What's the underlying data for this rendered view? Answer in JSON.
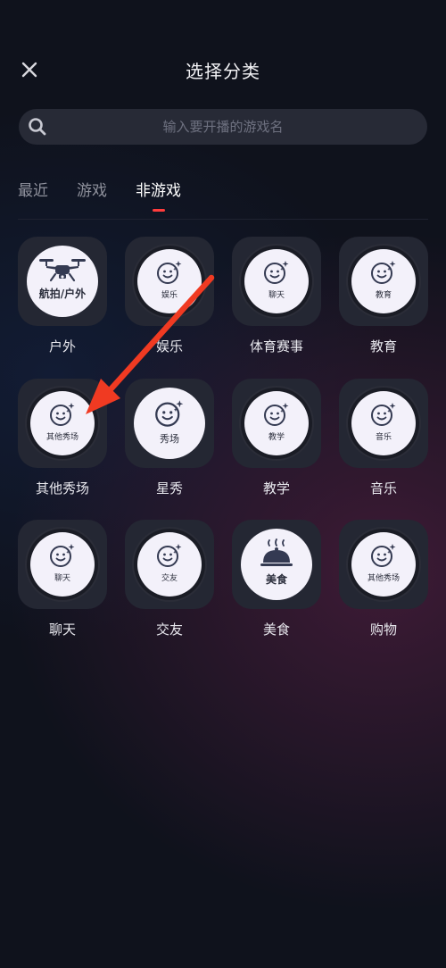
{
  "header": {
    "title": "选择分类",
    "close_icon": "close-icon"
  },
  "search": {
    "placeholder": "输入要开播的游戏名",
    "value": ""
  },
  "tabs": [
    {
      "label": "最近",
      "active": false
    },
    {
      "label": "游戏",
      "active": false
    },
    {
      "label": "非游戏",
      "active": true
    }
  ],
  "categories": [
    {
      "label": "户外",
      "badge_text": "航拍/户外",
      "icon": "drone-icon"
    },
    {
      "label": "娱乐",
      "badge_text": "娱乐",
      "icon": "smile-icon"
    },
    {
      "label": "体育赛事",
      "badge_text": "聊天",
      "icon": "smile-icon"
    },
    {
      "label": "教育",
      "badge_text": "教育",
      "icon": "smile-icon"
    },
    {
      "label": "其他秀场",
      "badge_text": "其他秀场",
      "icon": "smile-icon"
    },
    {
      "label": "星秀",
      "badge_text": "秀场",
      "icon": "smile-icon"
    },
    {
      "label": "教学",
      "badge_text": "教学",
      "icon": "smile-icon"
    },
    {
      "label": "音乐",
      "badge_text": "音乐",
      "icon": "smile-icon"
    },
    {
      "label": "聊天",
      "badge_text": "聊天",
      "icon": "smile-icon"
    },
    {
      "label": "交友",
      "badge_text": "交友",
      "icon": "smile-icon"
    },
    {
      "label": "美食",
      "badge_text": "美食",
      "icon": "food-cloche-icon"
    },
    {
      "label": "购物",
      "badge_text": "其他秀场",
      "icon": "smile-icon"
    }
  ],
  "colors": {
    "accent": "#ff3c3c",
    "arrow": "#f03a22",
    "background": "#0f121c",
    "tile": "#242733"
  }
}
